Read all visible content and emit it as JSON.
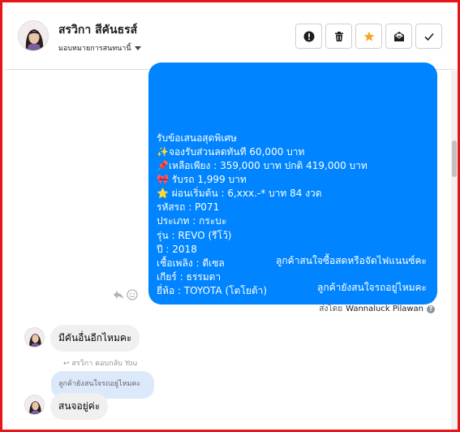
{
  "header": {
    "contact_name": "สรวิกา สีคันธรส์",
    "assign_label": "มอบหมายการสนทนานี้",
    "actions": [
      {
        "icon": "alert-circle-icon",
        "color": "#1c1e21"
      },
      {
        "icon": "trash-icon",
        "color": "#1c1e21"
      },
      {
        "icon": "star-icon",
        "color": "#f5a623"
      },
      {
        "icon": "envelope-icon",
        "color": "#1c1e21"
      },
      {
        "icon": "check-icon",
        "color": "#1c1e21"
      }
    ]
  },
  "conversation": {
    "big_message_lines": [
      "รับข้อเสนอสุดพิเศษ",
      "✨จองรับส่วนลดทันที 60,000 บาท",
      "📌เหลือเพียง : 359,000 บาท ปกติ 419,000 บาท",
      "🎀 รับรถ 1,999 บาท",
      "⭐ ผ่อนเริ่มต้น : 6,xxx.-* บาท 84 งวด",
      "รหัสรถ : P071",
      "ประเภท : กระบะ",
      "รุ่น : REVO (รีโว้)",
      "ปี : 2018",
      "เชื้อเพลิง : ดีเซล",
      "เกียร์ : ธรรมดา",
      "ยี่ห้อ : TOYOTA (โตโยต้า)"
    ],
    "outgoing_1": "ลูกค้าสนใจซื้อสดหรือจัดไฟแนนซ์คะ",
    "outgoing_2": "ลูกค้ายังสนใจรถอยู่ไหมคะ",
    "sent_by_prefix": "ส่งโดย",
    "sent_by_name": "Wannaluck Pilawan",
    "help_glyph": "?",
    "incoming_1": "มีคันอื่นอีกไหมคะ",
    "reply_meta": "สรวิกา ตอบกลับ You",
    "quoted_text": "ลูกค้ายังสนใจรถอยู่ไหมคะ",
    "incoming_2": "สนจอยู่ค่ะ"
  },
  "colors": {
    "accent": "#0084ff",
    "frame_border": "#e8141b",
    "incoming_bg": "#f0f0f0",
    "quoted_bg": "#dbe9fb"
  }
}
